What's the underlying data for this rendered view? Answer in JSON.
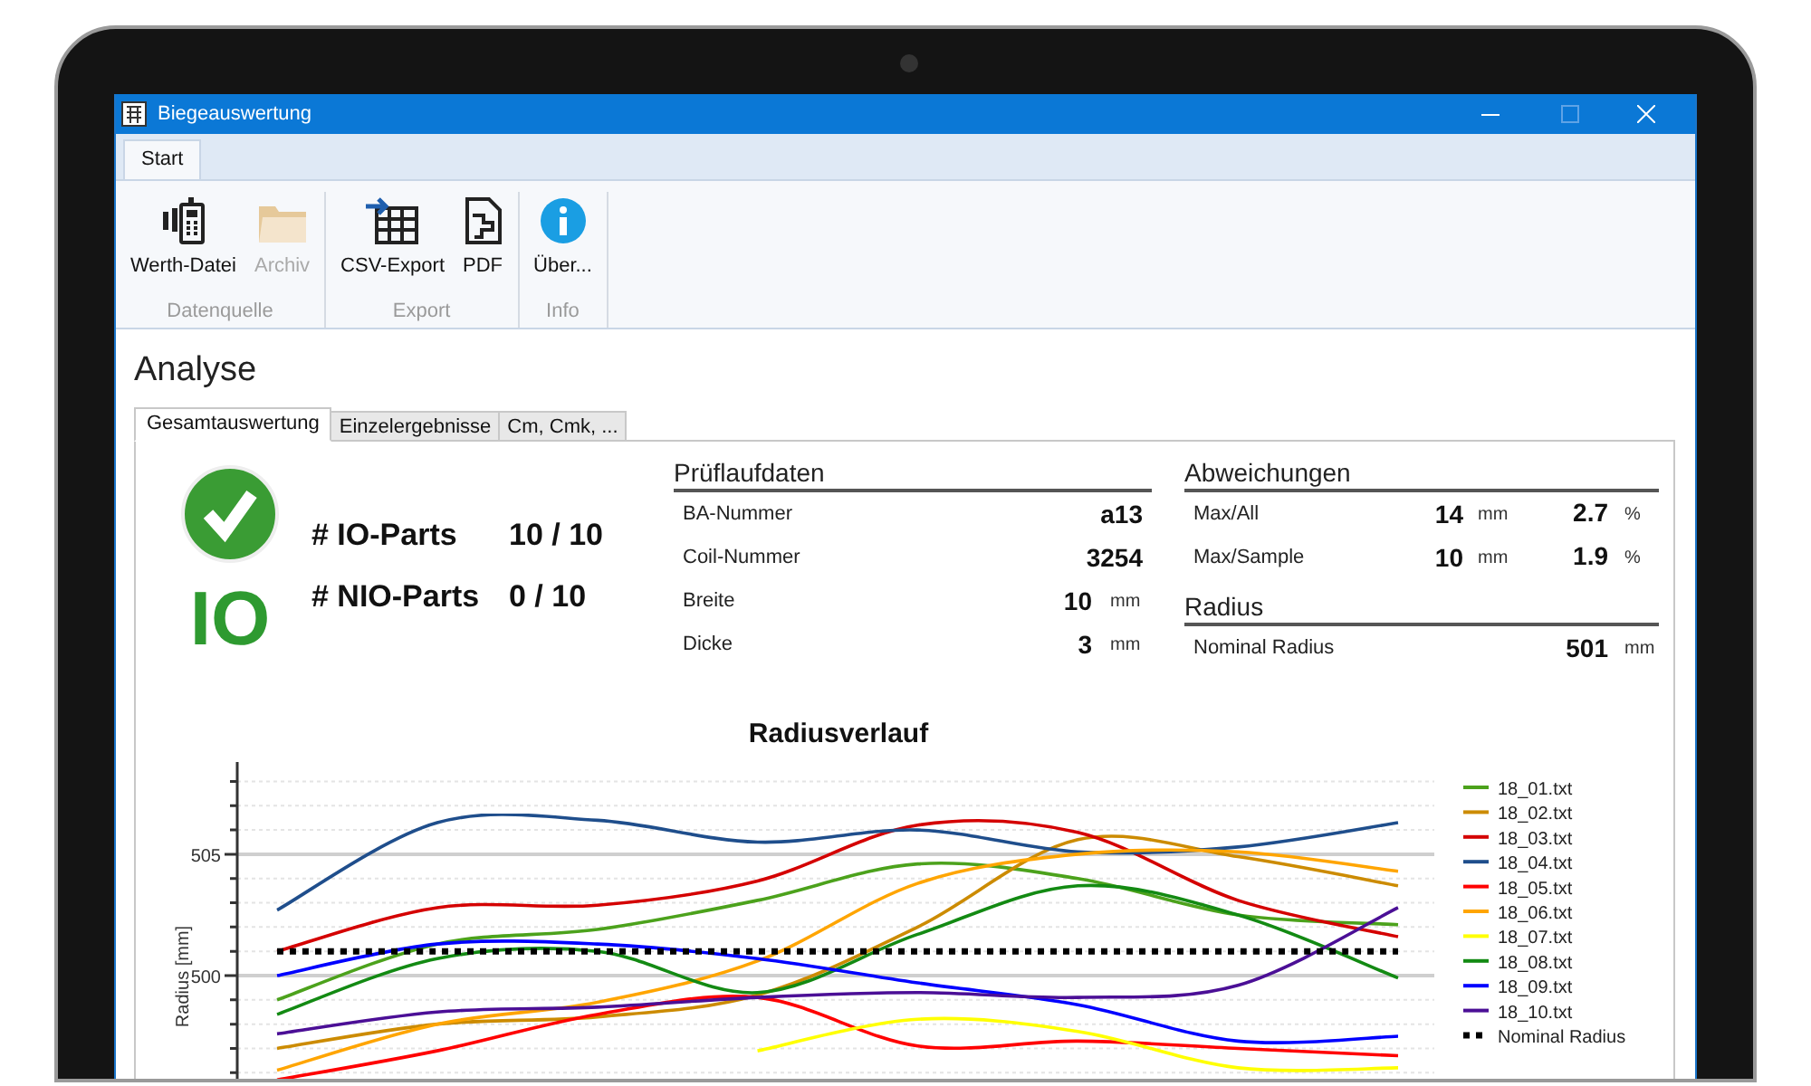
{
  "window": {
    "title": "Biegeauswertung",
    "maximize_enabled": false
  },
  "ribbon": {
    "tabs": [
      {
        "label": "Start",
        "selected": true
      }
    ],
    "groups": [
      {
        "label": "Datenquelle",
        "items": [
          {
            "label": "Werth-Datei",
            "disabled": false
          },
          {
            "label": "Archiv",
            "disabled": true
          }
        ]
      },
      {
        "label": "Export",
        "items": [
          {
            "label": "CSV-Export",
            "disabled": false
          },
          {
            "label": "PDF",
            "disabled": false
          }
        ]
      },
      {
        "label": "Info",
        "items": [
          {
            "label": "Über...",
            "disabled": false
          }
        ]
      }
    ]
  },
  "page_title": "Analyse",
  "tabs": [
    {
      "label": "Gesamtauswertung",
      "selected": true
    },
    {
      "label": "Einzelergebnisse",
      "selected": false
    },
    {
      "label": "Cm, Cmk, ...",
      "selected": false
    }
  ],
  "status": {
    "label": "IO",
    "ok": true
  },
  "counts": [
    {
      "label": "# IO-Parts",
      "value": "10 / 10"
    },
    {
      "label": "# NIO-Parts",
      "value": "0 / 10"
    }
  ],
  "pruflaufdaten": {
    "title": "Prüflaufdaten",
    "rows": [
      {
        "label": "BA-Nummer",
        "value": "a13"
      },
      {
        "label": "Coil-Nummer",
        "value": "3254"
      },
      {
        "label": "Breite",
        "value": "10",
        "unit": "mm"
      },
      {
        "label": "Dicke",
        "value": "3",
        "unit": "mm"
      }
    ]
  },
  "abweichungen": {
    "title": "Abweichungen",
    "rows": [
      {
        "label": "Max/All",
        "value": "14",
        "unit": "mm",
        "percent": "2.7",
        "percent_unit": "%"
      },
      {
        "label": "Max/Sample",
        "value": "10",
        "unit": "mm",
        "percent": "1.9",
        "percent_unit": "%"
      }
    ]
  },
  "radius": {
    "title": "Radius",
    "rows": [
      {
        "label": "Nominal Radius",
        "value": "501",
        "unit": "mm"
      }
    ]
  },
  "chart_data": {
    "type": "line",
    "title": "Radiusverlauf",
    "ylabel": "Radius [mm]",
    "legend": true,
    "ylim": [
      495.6,
      508.8
    ],
    "yticks": [
      500,
      505
    ],
    "series": [
      {
        "name": "18_01.txt",
        "color": "#4ca21c",
        "values": [
          499.0,
          501.3,
          501.9,
          503.1,
          504.6,
          504.0,
          502.5,
          502.1
        ]
      },
      {
        "name": "18_02.txt",
        "color": "#cc8b00",
        "values": [
          497.0,
          498.0,
          498.3,
          499.2,
          502.0,
          505.6,
          504.9,
          503.7
        ]
      },
      {
        "name": "18_03.txt",
        "color": "#d40000",
        "values": [
          501.0,
          502.8,
          502.9,
          503.9,
          506.2,
          505.9,
          503.1,
          501.6
        ]
      },
      {
        "name": "18_04.txt",
        "color": "#1f4e8c",
        "values": [
          502.7,
          506.3,
          506.4,
          505.5,
          506.0,
          505.1,
          505.3,
          506.3
        ]
      },
      {
        "name": "18_05.txt",
        "color": "#ff0000",
        "values": [
          495.7,
          496.9,
          498.4,
          499.1,
          497.1,
          497.3,
          497.0,
          496.7
        ]
      },
      {
        "name": "18_06.txt",
        "color": "#ffa500",
        "values": [
          496.1,
          498.0,
          498.9,
          500.6,
          503.8,
          505.0,
          505.1,
          504.3
        ]
      },
      {
        "name": "18_07.txt",
        "color": "#ffff00",
        "values": [
          null,
          null,
          null,
          496.9,
          498.2,
          497.7,
          496.2,
          496.2
        ]
      },
      {
        "name": "18_08.txt",
        "color": "#138a13",
        "values": [
          498.4,
          500.7,
          501.0,
          499.3,
          501.7,
          503.7,
          502.5,
          499.9
        ]
      },
      {
        "name": "18_09.txt",
        "color": "#0000ff",
        "values": [
          500.0,
          501.3,
          501.3,
          500.7,
          499.7,
          498.8,
          497.3,
          497.5
        ]
      },
      {
        "name": "18_10.txt",
        "color": "#4b0f96",
        "values": [
          497.6,
          498.5,
          498.7,
          499.1,
          499.3,
          499.1,
          499.6,
          502.8
        ]
      },
      {
        "name": "Nominal Radius",
        "color": "#000000",
        "line_style": "dotted",
        "values": [
          501,
          501,
          501,
          501,
          501,
          501,
          501,
          501
        ]
      }
    ]
  }
}
